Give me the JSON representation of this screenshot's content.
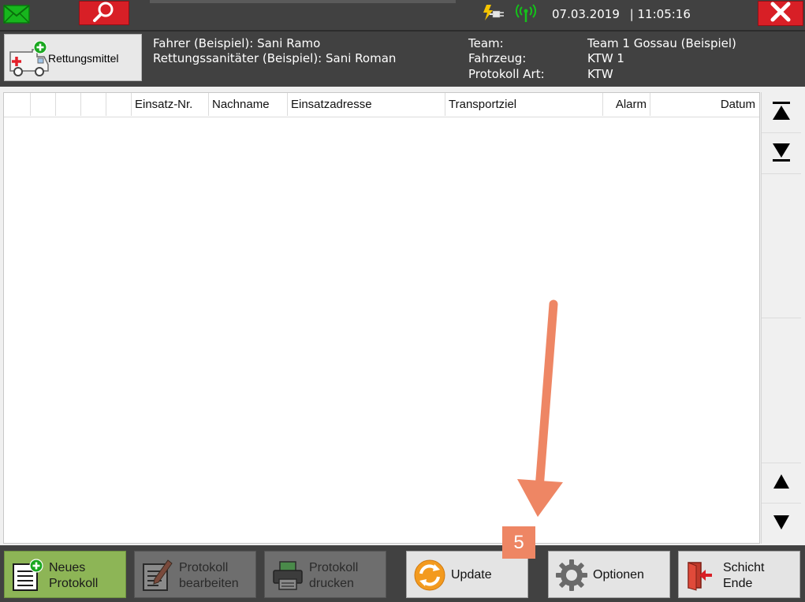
{
  "topbar": {
    "date": "07.03.2019",
    "time_separator": "|",
    "time": "11:05:16",
    "icons": [
      "mail-icon",
      "search-icon",
      "power-plug-icon",
      "signal-icon",
      "close-icon"
    ],
    "colors": {
      "bar": "#414141",
      "red_button": "#d81f26",
      "signal_green": "#14c21a"
    }
  },
  "header": {
    "rettungsmittel_label": "Rettungsmittel",
    "fahrer_label": "Fahrer (Beispiel):",
    "fahrer_value": "Sani Ramo",
    "sanitaeter_label": "Rettungssanitäter (Beispiel):",
    "sanitaeter_value": "Sani Roman",
    "team_label": "Team:",
    "team_value": "Team 1 Gossau (Beispiel)",
    "fahrzeug_label": "Fahrzeug:",
    "fahrzeug_value": "KTW 1",
    "protokoll_art_label": "Protokoll Art:",
    "protokoll_art_value": "KTW"
  },
  "table": {
    "columns": [
      "",
      "",
      "",
      "",
      "",
      "Einsatz-Nr.",
      "Nachname",
      "Einsatzadresse",
      "Transportziel",
      "Alarm",
      "Datum"
    ],
    "rows": []
  },
  "scroll": {
    "icons": [
      "scroll-top-icon",
      "scroll-bottom-icon",
      "scroll-up-icon",
      "scroll-down-icon"
    ]
  },
  "footer": {
    "neues_line1": "Neues",
    "neues_line2": "Protokoll",
    "bearbeiten_line1": "Protokoll",
    "bearbeiten_line2": "bearbeiten",
    "drucken_line1": "Protokoll",
    "drucken_line2": "drucken",
    "update": "Update",
    "optionen": "Optionen",
    "schicht_line1": "Schicht",
    "schicht_line2": "Ende",
    "colors": {
      "neues_bg": "#8db556",
      "disabled_bg": "#6e6e6e",
      "normal_bg": "#e4e4e4",
      "update_orange": "#f39a1e"
    }
  },
  "annotation": {
    "step_number": "5",
    "color": "#ee8664"
  }
}
